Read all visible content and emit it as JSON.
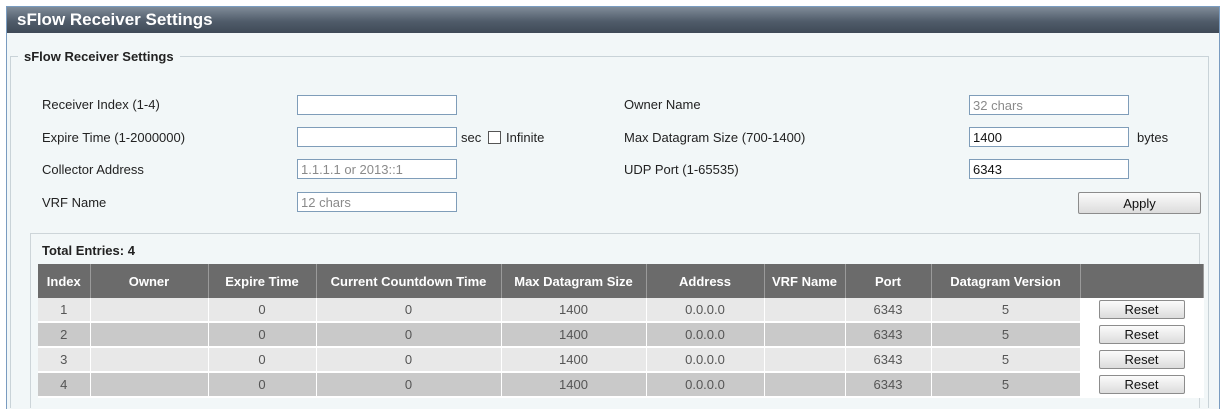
{
  "window": {
    "title": "sFlow Receiver Settings"
  },
  "form": {
    "legend": "sFlow Receiver Settings",
    "receiver_index": {
      "label": "Receiver Index (1-4)",
      "value": "",
      "placeholder": ""
    },
    "expire_time": {
      "label": "Expire Time (1-2000000)",
      "value": "",
      "placeholder": "",
      "unit": "sec",
      "infinite_label": "Infinite",
      "infinite_checked": false
    },
    "collector_address": {
      "label": "Collector Address",
      "value": "",
      "placeholder": "1.1.1.1 or 2013::1"
    },
    "vrf_name": {
      "label": "VRF Name",
      "value": "",
      "placeholder": "12 chars"
    },
    "owner_name": {
      "label": "Owner Name",
      "value": "",
      "placeholder": "32 chars"
    },
    "max_datagram_size": {
      "label": "Max Datagram Size (700-1400)",
      "value": "1400",
      "unit": "bytes"
    },
    "udp_port": {
      "label": "UDP Port (1-65535)",
      "value": "6343"
    },
    "apply_label": "Apply"
  },
  "table": {
    "total_label": "Total Entries: 4",
    "columns": [
      "Index",
      "Owner",
      "Expire Time",
      "Current Countdown Time",
      "Max Datagram Size",
      "Address",
      "VRF Name",
      "Port",
      "Datagram Version",
      ""
    ],
    "rows": [
      {
        "index": "1",
        "owner": "",
        "expire": "0",
        "countdown": "0",
        "max_size": "1400",
        "address": "0.0.0.0",
        "vrf": "",
        "port": "6343",
        "version": "5",
        "action": "Reset"
      },
      {
        "index": "2",
        "owner": "",
        "expire": "0",
        "countdown": "0",
        "max_size": "1400",
        "address": "0.0.0.0",
        "vrf": "",
        "port": "6343",
        "version": "5",
        "action": "Reset"
      },
      {
        "index": "3",
        "owner": "",
        "expire": "0",
        "countdown": "0",
        "max_size": "1400",
        "address": "0.0.0.0",
        "vrf": "",
        "port": "6343",
        "version": "5",
        "action": "Reset"
      },
      {
        "index": "4",
        "owner": "",
        "expire": "0",
        "countdown": "0",
        "max_size": "1400",
        "address": "0.0.0.0",
        "vrf": "",
        "port": "6343",
        "version": "5",
        "action": "Reset"
      }
    ]
  }
}
